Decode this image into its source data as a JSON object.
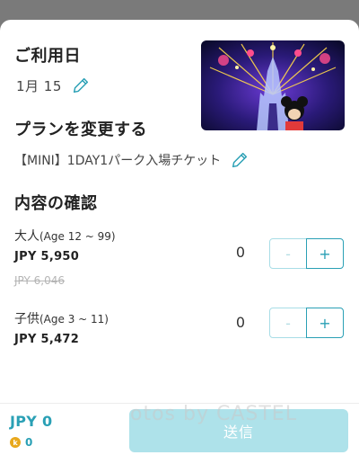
{
  "date_section": {
    "title": "ご利用日",
    "value": "1月 15"
  },
  "plan_section": {
    "title": "プランを変更する",
    "value": "【MINI】1DAY1パーク入場チケット"
  },
  "confirm_section": {
    "title": "内容の確認",
    "tickets": [
      {
        "name": "大人",
        "age": "(Age 12 ~ 99)",
        "price": "JPY 5,950",
        "original_price": "JPY 6,046",
        "quantity": "0"
      },
      {
        "name": "子供",
        "age": "(Age 3 ~ 11)",
        "price": "JPY 5,472",
        "quantity": "0"
      }
    ],
    "minus_label": "-",
    "plus_label": "+"
  },
  "footer": {
    "total": "JPY 0",
    "points": "0",
    "coin_symbol": "k",
    "submit_label": "送信"
  },
  "watermark": "otos by CASTEL",
  "colors": {
    "accent": "#2aa0b5",
    "submit_disabled": "#aee2ea",
    "coin": "#e8a81c"
  },
  "icons": {
    "edit": "pencil-icon",
    "coin": "coin-icon"
  }
}
